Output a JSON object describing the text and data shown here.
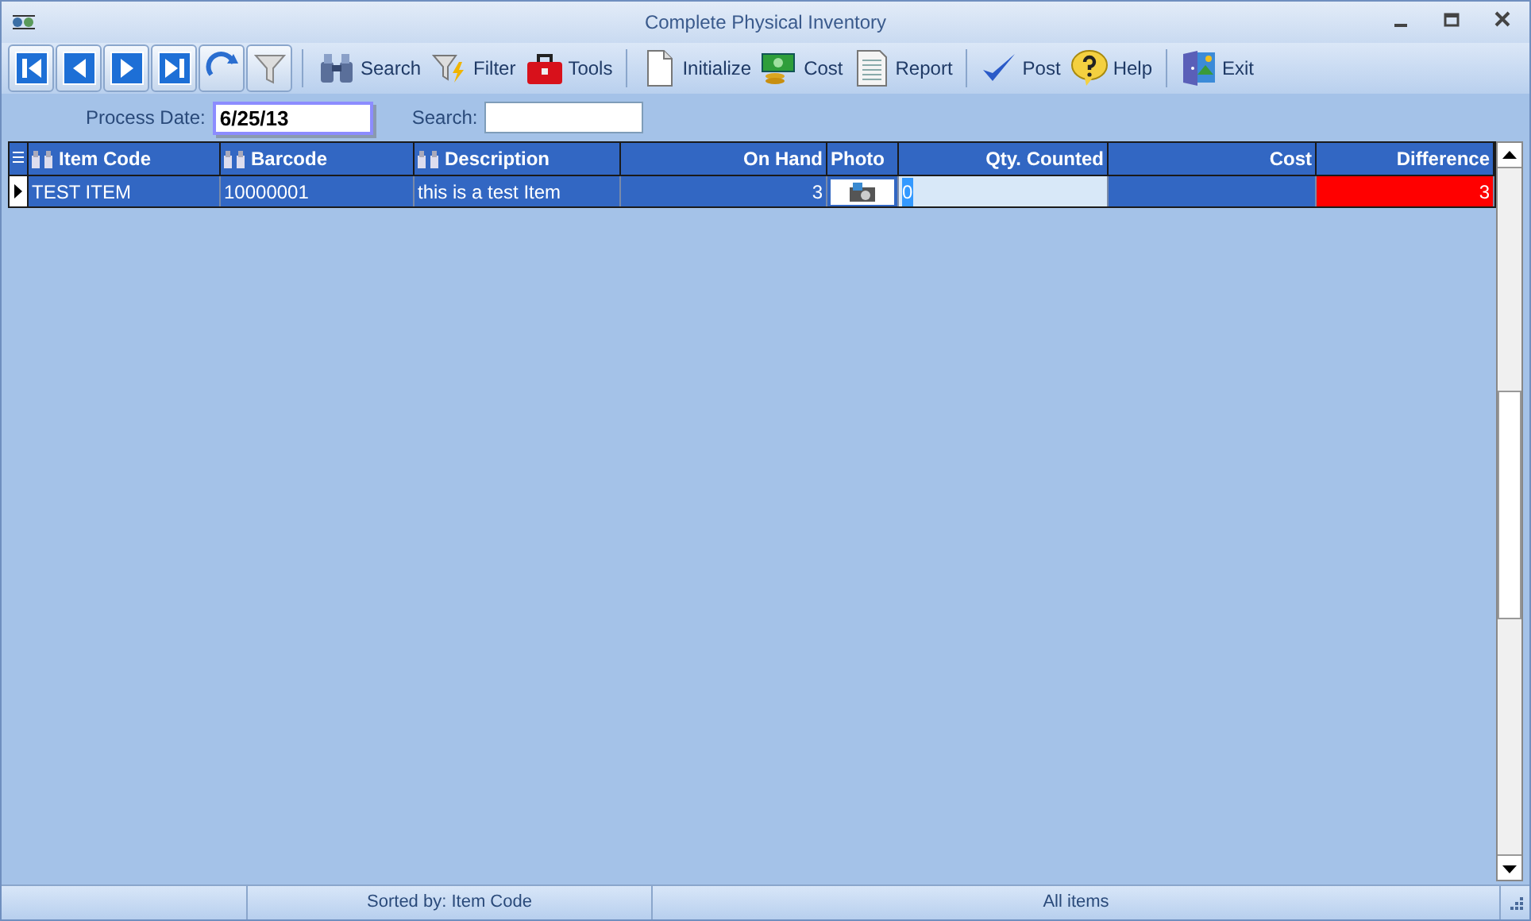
{
  "window": {
    "title": "Complete Physical Inventory"
  },
  "nav_buttons": [
    {
      "kind": "first"
    },
    {
      "kind": "prev"
    },
    {
      "kind": "next"
    },
    {
      "kind": "last"
    },
    {
      "kind": "refresh"
    },
    {
      "kind": "filter"
    }
  ],
  "toolbar": [
    {
      "kind": "search",
      "label": "Search"
    },
    {
      "kind": "filter",
      "label": "Filter"
    },
    {
      "kind": "tools",
      "label": "Tools"
    },
    {
      "kind": "sep"
    },
    {
      "kind": "initialize",
      "label": "Initialize"
    },
    {
      "kind": "cost",
      "label": "Cost"
    },
    {
      "kind": "report",
      "label": "Report"
    },
    {
      "kind": "sep"
    },
    {
      "kind": "post",
      "label": "Post"
    },
    {
      "kind": "help",
      "label": "Help"
    },
    {
      "kind": "sep"
    },
    {
      "kind": "exit",
      "label": "Exit"
    }
  ],
  "process_date": {
    "label": "Process Date:",
    "value": "6/25/13"
  },
  "search": {
    "label": "Search:"
  },
  "table": {
    "columns": [
      {
        "label": "Item Code",
        "kind": "searchable"
      },
      {
        "label": "Barcode",
        "kind": "searchable"
      },
      {
        "label": "Description",
        "kind": "searchable"
      },
      {
        "label": "On Hand",
        "kind": "numeric"
      },
      {
        "label": "Photo",
        "kind": "photo"
      },
      {
        "label": "Qty. Counted",
        "kind": "numeric"
      },
      {
        "label": "Cost",
        "kind": "numeric"
      },
      {
        "label": "Difference",
        "kind": "numeric"
      }
    ],
    "rows": [
      {
        "selected": true,
        "item_code": "TEST ITEM",
        "barcode": "10000001",
        "description": "this is a test Item",
        "on_hand": "3",
        "qty_counted": "0",
        "difference": "3",
        "color": "#ff0000"
      }
    ]
  },
  "status_bar": [
    "Sorted by: Item Code",
    "All items"
  ]
}
